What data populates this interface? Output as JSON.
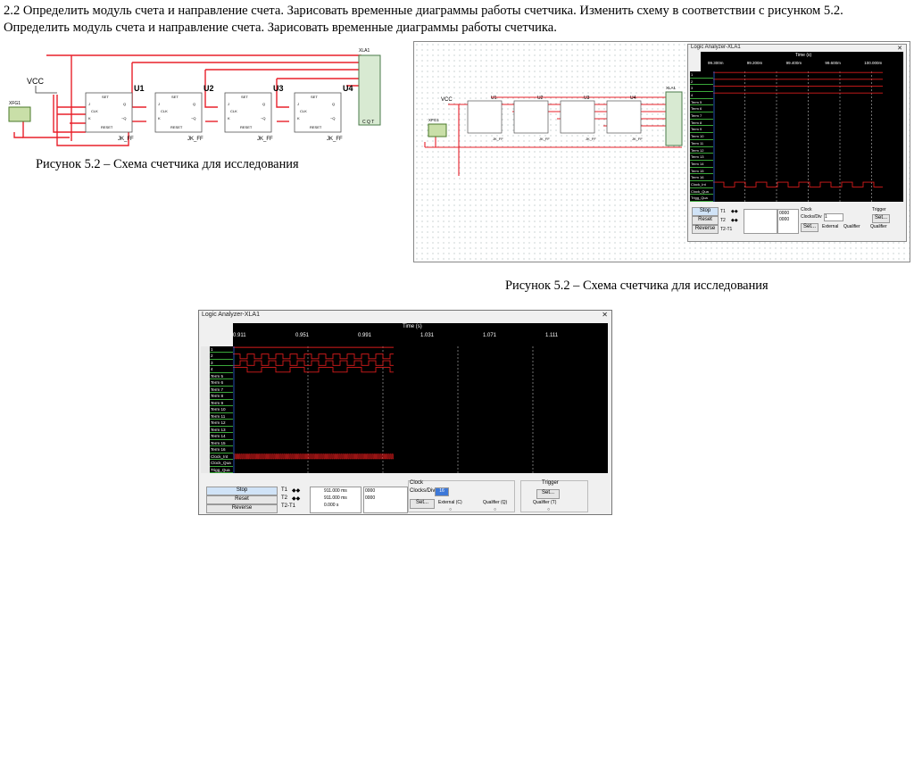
{
  "task": {
    "text": "2.2 Определить модуль счета и направление счета. Зарисовать временные диаграммы работы счетчика. Изменить схему в соответствии с рисунком 5.2. Определить модуль счета и направление счета. Зарисовать временные диаграммы работы счетчика."
  },
  "figure1": {
    "caption": "Рисунок 5.2 – Схема счетчика для исследования",
    "vcc_label": "VCC",
    "gen_label": "XFG1",
    "analyzer_label": "XLA1",
    "analyzer_pins": "C Q T",
    "chips": [
      {
        "name": "U1",
        "type": "JK_FF",
        "top": "SET",
        "bottom": "RESET",
        "j": "J",
        "k": "K",
        "q": "Q",
        "nq": "~Q",
        "clk": "CLK"
      },
      {
        "name": "U2",
        "type": "JK_FF",
        "top": "SET",
        "bottom": "RESET",
        "j": "J",
        "k": "K",
        "q": "Q",
        "nq": "~Q",
        "clk": "CLK"
      },
      {
        "name": "U3",
        "type": "JK_FF",
        "top": "SET",
        "bottom": "RESET",
        "j": "J",
        "k": "K",
        "q": "Q",
        "nq": "~Q",
        "clk": "CLK"
      },
      {
        "name": "U4",
        "type": "JK_FF",
        "top": "SET",
        "bottom": "RESET",
        "j": "J",
        "k": "K",
        "q": "Q",
        "nq": "~Q",
        "clk": "CLK"
      }
    ]
  },
  "figure2": {
    "caption": "Рисунок 5.2 – Схема счетчика для исследования",
    "vcc_label": "VCC",
    "gen_label": "XFG1",
    "analyzer_label": "XLA1",
    "chips": [
      "U1",
      "U2",
      "U3",
      "U4"
    ],
    "chip_type": "JK_FF",
    "la": {
      "title": "Logic Analyzer-XLA1",
      "time_label": "Time (s)",
      "ticks": [
        "99.300m",
        "99.200m",
        "99.400m",
        "99.600m",
        "100.000m"
      ],
      "channels": [
        "1",
        "2",
        "3",
        "4",
        "Term 5",
        "Term 6",
        "Term 7",
        "Term 8",
        "Term 9",
        "Term 10",
        "Term 11",
        "Term 12",
        "Term 13",
        "Term 14",
        "Term 15",
        "Term 16",
        "Clock_Int",
        "Clock_Qua",
        "Trigg_Qua"
      ],
      "stop": "Stop",
      "reset": "Reset",
      "reverse": "Reverse",
      "t1": "T1",
      "t2": "T2",
      "t2t1": "T2-T1",
      "t1_value": "0000",
      "t2_value": "0000",
      "clock": "Clock",
      "clocks_div": "Clocks/Div",
      "clocks_div_value": "1",
      "set": "Set...",
      "external": "External",
      "qualifier": "Qualifier",
      "trigger": "Trigger",
      "trigger_qualifier": "Qualifier"
    }
  },
  "figure3": {
    "title": "Logic Analyzer-XLA1",
    "time_label": "Time (s)",
    "ticks": [
      "0.911",
      "0.951",
      "0.991",
      "1.031",
      "1.071",
      "1.111"
    ],
    "channels": [
      "1",
      "2",
      "3",
      "4",
      "Term 5",
      "Term 6",
      "Term 7",
      "Term 8",
      "Term 9",
      "Term 10",
      "Term 11",
      "Term 12",
      "Term 13",
      "Term 14",
      "Term 15",
      "Term 16",
      "Clock_Int",
      "Clock_Qua",
      "Trigg_Qua"
    ],
    "stop": "Stop",
    "reset": "Reset",
    "reverse": "Reverse",
    "t1": "T1",
    "t2": "T2",
    "t2t1": "T2-T1",
    "t1_time": "911.000 ms",
    "t2_time": "911.000 ms",
    "t2t1_time": "0.000 s",
    "t1_code": "0000",
    "t2_code": "0000",
    "clock": "Clock",
    "clocks_div": "Clocks/Div",
    "clocks_div_value": "16",
    "set": "Set...",
    "external": "External (C)",
    "qualifier": "Qualifier (Q)",
    "trigger": "Trigger",
    "trigger_set": "Set...",
    "trigger_qualifier": "Qualifier (T)"
  },
  "colors": {
    "wire": "#e8202a",
    "trace": "#d81c1c",
    "scope_bg": "#000000",
    "channel_bg": "#000000",
    "channel_text": "#ffffff",
    "panel_bg": "#f0f0f0",
    "cursor": "#2d62d6"
  }
}
